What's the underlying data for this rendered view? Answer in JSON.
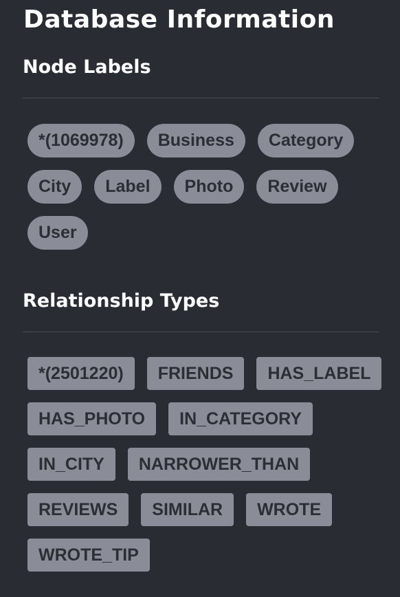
{
  "panel": {
    "title": "Database Information"
  },
  "node_labels": {
    "heading": "Node Labels",
    "items": [
      {
        "label": "*(1069978)"
      },
      {
        "label": "Business"
      },
      {
        "label": "Category"
      },
      {
        "label": "City"
      },
      {
        "label": "Label"
      },
      {
        "label": "Photo"
      },
      {
        "label": "Review"
      },
      {
        "label": "User"
      }
    ]
  },
  "relationship_types": {
    "heading": "Relationship Types",
    "items": [
      {
        "label": "*(2501220)"
      },
      {
        "label": "FRIENDS"
      },
      {
        "label": "HAS_LABEL"
      },
      {
        "label": "HAS_PHOTO"
      },
      {
        "label": "IN_CATEGORY"
      },
      {
        "label": "IN_CITY"
      },
      {
        "label": "NARROWER_THAN"
      },
      {
        "label": "REVIEWS"
      },
      {
        "label": "SIMILAR"
      },
      {
        "label": "WROTE"
      },
      {
        "label": "WROTE_TIP"
      }
    ]
  },
  "colors": {
    "background": "#2a2c33",
    "chip_background": "#8a8c97",
    "chip_text": "#2c2e35",
    "heading_text": "#ffffff",
    "divider": "#4a4d55"
  }
}
